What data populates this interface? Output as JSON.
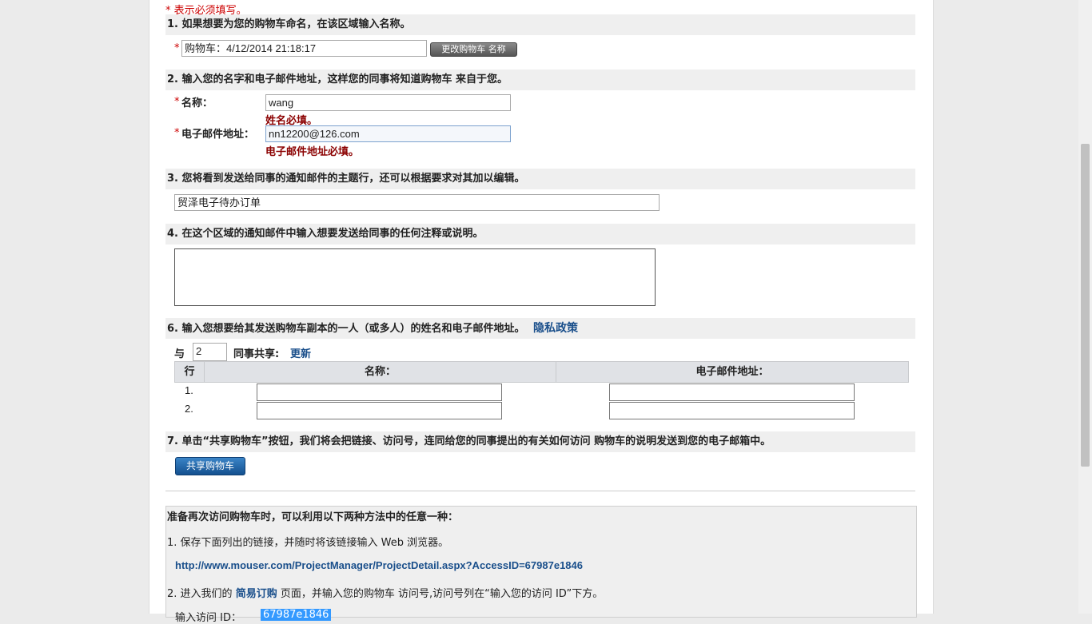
{
  "required_note": "* 表示必须填写。",
  "section1": {
    "heading": "1. 如果想要为您的购物车命名，在该区域输入名称。",
    "cart_name_value": "购物车：4/12/2014 21:18:17",
    "rename_button": "更改购物车 名称"
  },
  "section2": {
    "heading": "2. 输入您的名字和电子邮件地址，这样您的同事将知道购物车 来自于您。",
    "name_label": "名称：",
    "name_value": "wang",
    "name_error": "姓名必填。",
    "email_label": "电子邮件地址：",
    "email_value": "nn12200@126.com",
    "email_error": "电子邮件地址必填。"
  },
  "section3": {
    "heading": "3. 您将看到发送给同事的通知邮件的主题行，还可以根据要求对其加以编辑。",
    "subject_value": "贸泽电子待办订单"
  },
  "section4": {
    "heading": "4. 在这个区域的通知邮件中输入想要发送给同事的任何注释或说明。",
    "notes_value": ""
  },
  "section6": {
    "heading": "6. 输入您想要给其发送购物车副本的一人（或多人）的姓名和电子邮件地址。",
    "privacy_link": "隐私政策",
    "share_prefix": "与",
    "share_count": "2",
    "share_suffix": "同事共享:",
    "update_link": "更新",
    "columns": [
      "行",
      "名称：",
      "电子邮件地址："
    ],
    "rows": [
      {
        "index": "1.",
        "name": "",
        "email": ""
      },
      {
        "index": "2.",
        "name": "",
        "email": ""
      }
    ]
  },
  "section7": {
    "heading": "7. 单击“共享购物车”按钮，我们将会把链接、访问号，连同给您的同事提出的有关如何访问 购物车的说明发送到您的电子邮箱中。",
    "share_button": "共享购物车"
  },
  "revisit": {
    "intro": "准备再次访问购物车时，可以利用以下两种方法中的任意一种：",
    "method1": "1. 保存下面列出的链接，并随时将该链接输入 Web 浏览器。",
    "url": "http://www.mouser.com/ProjectManager/ProjectDetail.aspx?AccessID=67987e1846",
    "method2_prefix": "2. 进入我们的",
    "method2_link": "简易订购",
    "method2_suffix": "页面，并输入您的购物车 访问号,访问号列在“输入您的访问 ID”下方。",
    "access_label": "输入访问 ID：",
    "access_value": "67987e1846"
  }
}
